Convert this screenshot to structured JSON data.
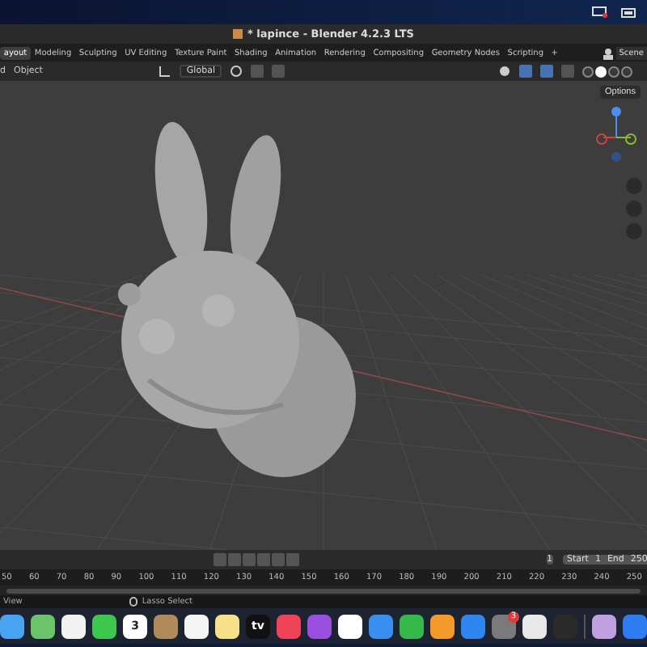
{
  "window": {
    "title": "* lapince - Blender 4.2.3 LTS"
  },
  "workspace_tabs": [
    {
      "label": "ayout",
      "selected": true
    },
    {
      "label": "Modeling",
      "selected": false
    },
    {
      "label": "Sculpting",
      "selected": false
    },
    {
      "label": "UV Editing",
      "selected": false
    },
    {
      "label": "Texture Paint",
      "selected": false
    },
    {
      "label": "Shading",
      "selected": false
    },
    {
      "label": "Animation",
      "selected": false
    },
    {
      "label": "Rendering",
      "selected": false
    },
    {
      "label": "Compositing",
      "selected": false
    },
    {
      "label": "Geometry Nodes",
      "selected": false
    },
    {
      "label": "Scripting",
      "selected": false
    }
  ],
  "add_tab": "+",
  "scene": "Scene",
  "header": {
    "menus": [
      "d",
      "Object"
    ],
    "orientation": "Global"
  },
  "shading_modes": [
    {
      "selected": false
    },
    {
      "selected": true
    },
    {
      "selected": false
    },
    {
      "selected": false
    }
  ],
  "viewport": {
    "options": "Options"
  },
  "timeline": {
    "current_frame": "1",
    "start_label": "Start",
    "start": "1",
    "end_label": "End",
    "end": "250",
    "ticks": [
      "50",
      "60",
      "70",
      "80",
      "90",
      "100",
      "110",
      "120",
      "130",
      "140",
      "150",
      "160",
      "170",
      "180",
      "190",
      "200",
      "210",
      "220",
      "230",
      "240",
      "250"
    ]
  },
  "status_bar": {
    "view": "View",
    "lasso": "Lasso Select"
  },
  "dock": [
    {
      "kind": "finder"
    },
    {
      "kind": "maps"
    },
    {
      "kind": "photos"
    },
    {
      "kind": "facetime"
    },
    {
      "kind": "calendar",
      "text": "3"
    },
    {
      "kind": "contacts"
    },
    {
      "kind": "reminders"
    },
    {
      "kind": "notes"
    },
    {
      "kind": "tv",
      "text": "tv"
    },
    {
      "kind": "music"
    },
    {
      "kind": "podcasts"
    },
    {
      "kind": "news"
    },
    {
      "kind": "keynote"
    },
    {
      "kind": "numbers"
    },
    {
      "kind": "pages"
    },
    {
      "kind": "appstore"
    },
    {
      "kind": "settings",
      "badge": "3"
    },
    {
      "kind": "roblox"
    },
    {
      "kind": "blender"
    },
    {
      "kind": "separator"
    },
    {
      "kind": "colorsync"
    },
    {
      "kind": "bluetooth"
    }
  ]
}
